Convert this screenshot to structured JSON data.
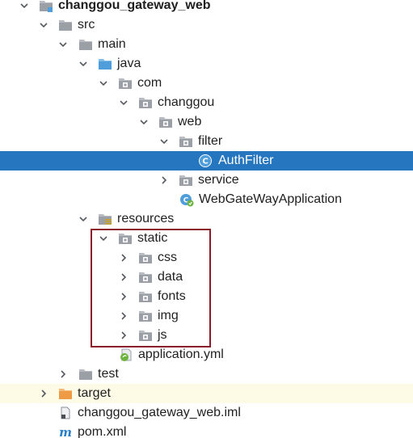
{
  "tree": {
    "root": {
      "label": "changgou_gateway_web",
      "icon": "module-folder-icon"
    },
    "src": {
      "label": "src",
      "icon": "folder-icon"
    },
    "main": {
      "label": "main",
      "icon": "folder-icon"
    },
    "java": {
      "label": "java",
      "icon": "source-root-folder-icon"
    },
    "com": {
      "label": "com",
      "icon": "package-icon"
    },
    "changgou": {
      "label": "changgou",
      "icon": "package-icon"
    },
    "web": {
      "label": "web",
      "icon": "package-icon"
    },
    "filter": {
      "label": "filter",
      "icon": "package-icon"
    },
    "authfilter": {
      "label": "AuthFilter",
      "icon": "java-class-icon"
    },
    "service": {
      "label": "service",
      "icon": "package-icon"
    },
    "app": {
      "label": "WebGateWayApplication",
      "icon": "spring-boot-class-icon"
    },
    "resources": {
      "label": "resources",
      "icon": "resources-folder-icon"
    },
    "static": {
      "label": "static",
      "icon": "package-icon"
    },
    "css": {
      "label": "css",
      "icon": "package-icon"
    },
    "data": {
      "label": "data",
      "icon": "package-icon"
    },
    "fonts": {
      "label": "fonts",
      "icon": "package-icon"
    },
    "img": {
      "label": "img",
      "icon": "package-icon"
    },
    "js": {
      "label": "js",
      "icon": "package-icon"
    },
    "yml": {
      "label": "application.yml",
      "icon": "spring-yml-icon"
    },
    "test": {
      "label": "test",
      "icon": "folder-icon"
    },
    "target": {
      "label": "target",
      "icon": "excluded-folder-icon"
    },
    "iml": {
      "label": "changgou_gateway_web.iml",
      "icon": "iml-file-icon"
    },
    "pom": {
      "label": "pom.xml",
      "icon": "maven-icon"
    }
  },
  "colors": {
    "selection": "#2675bf",
    "highlight_border": "#8b1a2b",
    "excluded_background": "#fdfbe5",
    "folder": "#b8bcc2",
    "source_folder": "#5aa7e0",
    "excluded_folder": "#f0a050"
  }
}
